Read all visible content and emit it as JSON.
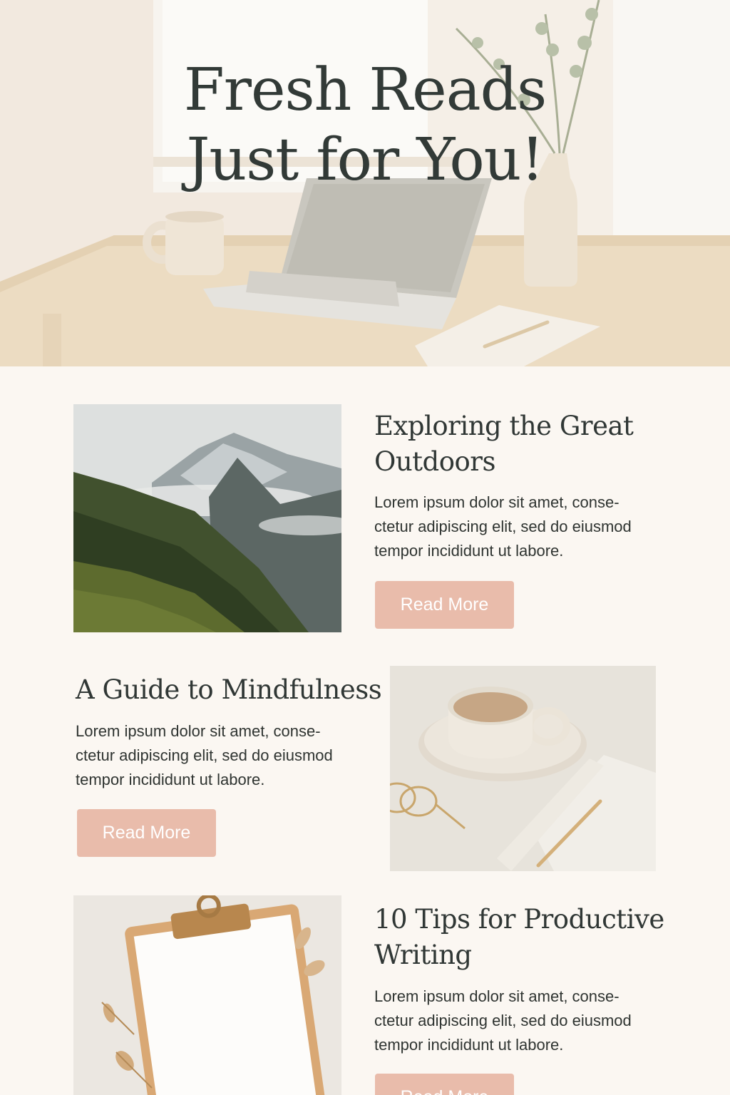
{
  "hero": {
    "title_line1": "Fresh Reads",
    "title_line2": "Just for You!"
  },
  "articles": [
    {
      "title": "Exploring the Great Outdoors",
      "text": "Lorem ipsum dolor sit amet, conse-\nctetur adipiscing elit, sed do eiusmod\ntempor incididunt ut labore.",
      "button_label": "Read More",
      "image": "mountain-landscape-photo"
    },
    {
      "title": "A Guide to Mindfulness",
      "text": "Lorem ipsum dolor sit amet, conse-\nctetur adipiscing elit, sed do eiusmod\ntempor incididunt ut labore.",
      "button_label": "Read More",
      "image": "coffee-cup-and-notebook-photo"
    },
    {
      "title": "10 Tips for Productive Writing",
      "text": "Lorem ipsum dolor sit amet, conse-\nctetur adipiscing elit, sed do eiusmod\ntempor incididunt ut labore.",
      "button_label": "Read More",
      "image": "clipboard-and-leaves-photo"
    }
  ],
  "colors": {
    "background": "#fbf7f2",
    "button": "#e9bcab",
    "button_text": "#ffffff",
    "heading": "#303735"
  }
}
